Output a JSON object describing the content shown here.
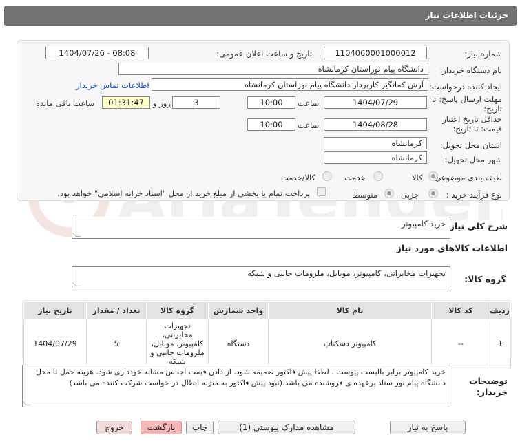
{
  "header": {
    "title": "جزئیات اطلاعات نیاز"
  },
  "form": {
    "need_number_label": "شماره نیاز:",
    "need_number": "1104060001000012",
    "announce_label": "تاریخ و ساعت اعلان عمومی:",
    "announce_value": "1404/07/26 - 08:08",
    "buyer_label": "نام دستگاه خریدار:",
    "buyer_value": "دانشگاه پیام نوراستان کرمانشاه",
    "creator_label": "ایجاد کننده درخواست:",
    "creator_value": "آرش کمانگیر کارپرداز دانشگاه پیام نوراستان کرمانشاه",
    "contact_link": "اطلاعات تماس خریدار",
    "deadline_label": "مهلت ارسال پاسخ: تا تاریخ:",
    "deadline_date": "1404/07/29",
    "time_label": "ساعت",
    "deadline_time": "10:00",
    "days_value": "3",
    "days_label": "روز و",
    "remaining_time": "01:31:47",
    "remaining_label": "ساعت باقی مانده",
    "validity_label": "حداقل تاریخ اعتبار قیمت: تا تاریخ:",
    "validity_date": "1404/08/28",
    "validity_time": "10:00",
    "province_label": "استان محل تحویل:",
    "province_value": "کرمانشاه",
    "city_label": "شهر محل تحویل:",
    "city_value": "کرمانشاه",
    "category_label": "طبقه بندی موضوعی:",
    "category_options": [
      "کالا",
      "خدمت",
      "کالا/خدمت"
    ],
    "category_selected": "کالا",
    "process_label": "نوع فرآیند خرید :",
    "process_options": [
      "جزیی",
      "متوسط"
    ],
    "process_selected": "جزیی",
    "payment_note": "پرداخت تمام یا بخشی از مبلغ خرید،از محل \"اسناد خزانه اسلامی\" خواهد بود."
  },
  "summary": {
    "label": "شرح کلی نیاز:",
    "value": "خرید کامپیوتر"
  },
  "goods_info": {
    "title": "اطلاعات کالاهای مورد نیاز"
  },
  "goods_group": {
    "label": "گروه کالا:",
    "value": "تجهیزات مخابراتی، کامپیوتر، موبایل، ملزومات جانبی و شبکه"
  },
  "table": {
    "headers": [
      "ردیف",
      "کد کالا",
      "نام کالا",
      "واحد شمارش",
      "گروه کالا",
      "تعداد / مقدار",
      "تاریخ نیاز"
    ],
    "rows": [
      [
        "1",
        "--",
        "کامپیوتر دسکتاپ",
        "دستگاه",
        "تجهیزات مخابراتی، کامپیوتر، موبایل، ملزومات جانبی و شبکه",
        "5",
        "1404/07/29"
      ]
    ]
  },
  "buyer_notes": {
    "label": "توضیحات خریدار:",
    "value": "خرید کامپیوتر برابر بالیست پیوست . لطفا پیش فاکتور ضمیمه شود. از دادن قیمت اجناس مشابه خودداری شود. هزینه حمل تا محل دانشگاه پیام نور ستاد برعهده ی فروشنده می باشد.(نبود پیش فاکتور به منزله ابطال در خواست شرکت کننده می باشد)"
  },
  "buttons": {
    "reply": "پاسخ به نیاز",
    "attachments": "مشاهده مدارک پیوستی (1)",
    "print": "چاپ",
    "back": "بازگشت",
    "exit": "خروج"
  },
  "watermark": {
    "text": "AriaTender.neT"
  }
}
